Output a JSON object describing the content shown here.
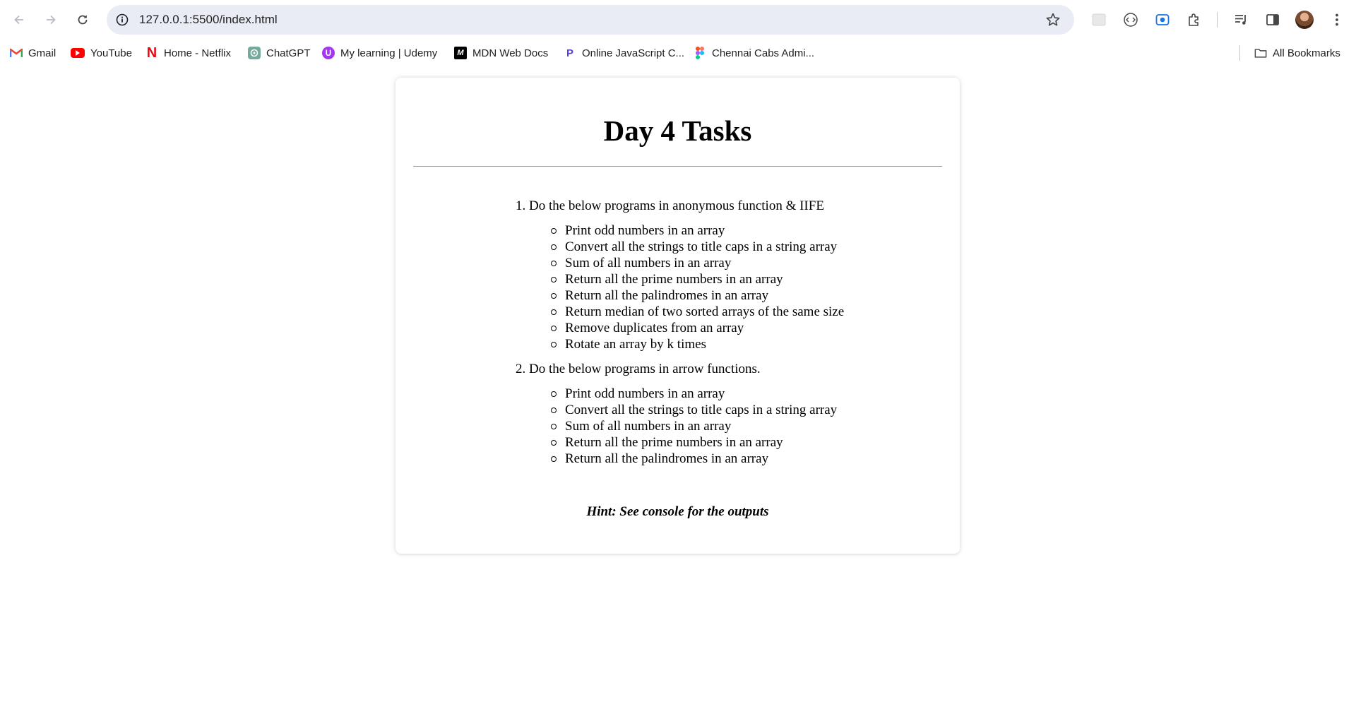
{
  "browser": {
    "url": "127.0.0.1:5500/index.html",
    "bookmarks": [
      {
        "label": "Gmail",
        "icon": "gmail-icon"
      },
      {
        "label": "YouTube",
        "icon": "youtube-icon"
      },
      {
        "label": "Home - Netflix",
        "icon": "netflix-icon"
      },
      {
        "label": "ChatGPT",
        "icon": "chatgpt-icon"
      },
      {
        "label": "My learning | Udemy",
        "icon": "udemy-icon"
      },
      {
        "label": "MDN Web Docs",
        "icon": "mdn-icon"
      },
      {
        "label": "Online JavaScript C...",
        "icon": "js-compiler-icon"
      },
      {
        "label": "Chennai Cabs Admi...",
        "icon": "figma-icon"
      }
    ],
    "all_bookmarks_label": "All Bookmarks"
  },
  "page": {
    "title": "Day 4 Tasks",
    "tasks": [
      {
        "number": "1.",
        "title": "Do the below programs in anonymous function & IIFE",
        "items": [
          "Print odd numbers in an array",
          "Convert all the strings to title caps in a string array",
          "Sum of all numbers in an array",
          "Return all the prime numbers in an array",
          "Return all the palindromes in an array",
          "Return median of two sorted arrays of the same size",
          "Remove duplicates from an array",
          "Rotate an array by k times"
        ]
      },
      {
        "number": "2.",
        "title": "Do the below programs in arrow functions.",
        "items": [
          "Print odd numbers in an array",
          "Convert all the strings to title caps in a string array",
          "Sum of all numbers in an array",
          "Return all the prime numbers in an array",
          "Return all the palindromes in an array"
        ]
      }
    ],
    "hint": "Hint: See console for the outputs"
  }
}
